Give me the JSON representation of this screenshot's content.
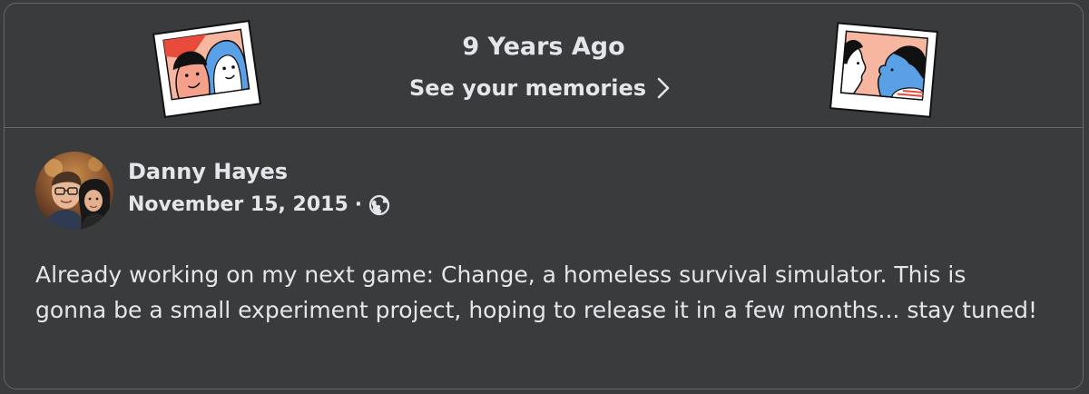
{
  "memories": {
    "title": "9 Years Ago",
    "link_label": "See your memories"
  },
  "post": {
    "author": "Danny Hayes",
    "date": "November 15, 2015",
    "separator": "·",
    "audience_icon": "globe-icon",
    "text": "Already working on my next game: Change, a homeless survival simulator. This is gonna be a small experiment project, hoping to release it in a few months... stay tuned!"
  },
  "colors": {
    "background": "#3a3b3c",
    "text": "#e4e6eb",
    "border": "#65676b"
  }
}
